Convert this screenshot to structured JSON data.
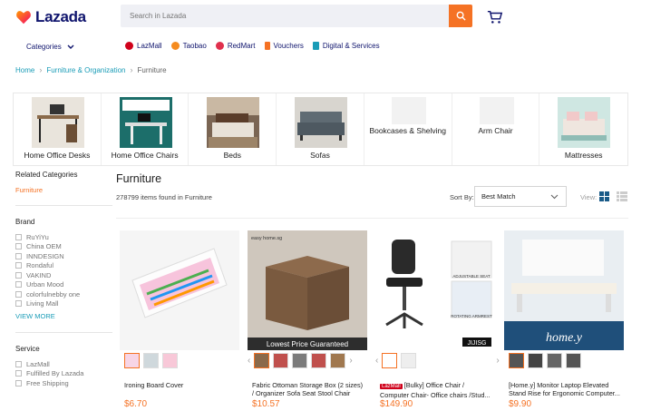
{
  "brand": {
    "name": "Lazada",
    "accent": "#f57224",
    "navy": "#0f146d"
  },
  "search": {
    "placeholder": "Search in Lazada"
  },
  "nav": {
    "categories": "Categories",
    "links": [
      {
        "label": "LazMall",
        "color": "#d0011b"
      },
      {
        "label": "Taobao",
        "color": "#f58b1f"
      },
      {
        "label": "RedMart",
        "color": "#e0304d"
      },
      {
        "label": "Vouchers",
        "color": "#f57224"
      },
      {
        "label": "Digital & Services",
        "color": "#1a9cb7"
      }
    ]
  },
  "breadcrumb": [
    "Home",
    "Furniture & Organization",
    "Furniture"
  ],
  "category_strip": [
    "Home Office Desks",
    "Home Office Chairs",
    "Beds",
    "Sofas",
    "Bookcases & Shelving",
    "Arm Chair",
    "Mattresses"
  ],
  "sidebar": {
    "related_heading": "Related Categories",
    "related_link": "Furniture",
    "brand_heading": "Brand",
    "brands": [
      "RuYiYu",
      "China OEM",
      "INNDESIGN",
      "Rondaful",
      "VAKIND",
      "Urban Mood",
      "colorfulnebby one",
      "Living Mall"
    ],
    "view_more": "VIEW MORE",
    "service_heading": "Service",
    "services": [
      "LazMall",
      "Fulfilled By Lazada",
      "Free Shipping"
    ]
  },
  "main": {
    "title": "Furniture",
    "count": "278799 items found in Furniture",
    "sort_label": "Sort By:",
    "sort_value": "Best Match",
    "view_label": "View:"
  },
  "products": [
    {
      "name": "Ironing Board Cover",
      "price": "$6.70",
      "badge": ""
    },
    {
      "name": "Fabric Ottoman Storage Box (2 sizes) / Organizer Sofa Seat Stool Chair",
      "price": "$10.57",
      "badge": "",
      "banner": "Lowest Price Guaranteed",
      "corner": "easy home.sg"
    },
    {
      "name": "[Bulky] Office Chair / Computer Chair- Office chairs /Stud...",
      "price": "$149.90",
      "badge": "LazMall",
      "corner": "JIJISG",
      "tag1": "ADJUSTABLE SEAT",
      "tag2": "ROTATING ARMREST"
    },
    {
      "name": "[Home.y] Monitor Laptop Elevated Stand Rise for Ergonomic Computer...",
      "price": "$9.90",
      "badge": "",
      "overlay": "home.y"
    }
  ]
}
